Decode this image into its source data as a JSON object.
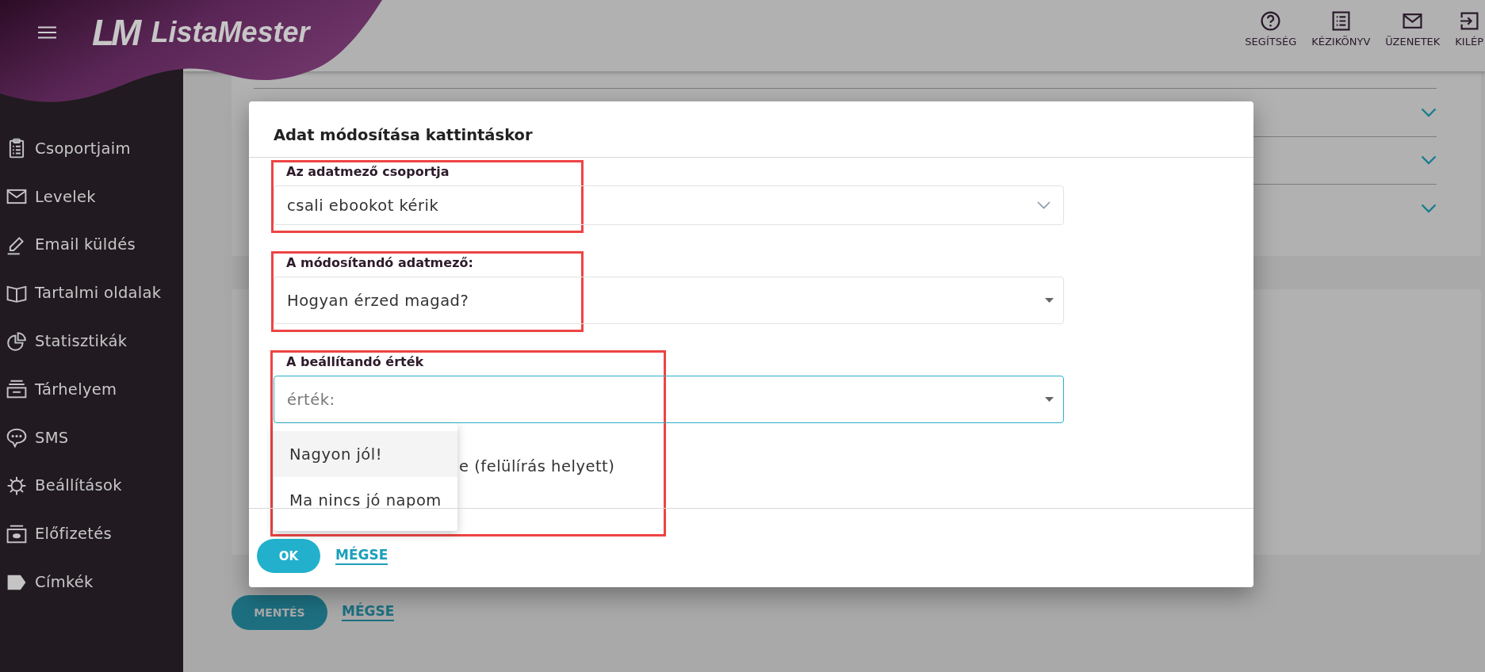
{
  "header": {
    "brand": {
      "mark": "LM",
      "name": "ListaMester"
    },
    "nav": [
      {
        "label": "SEGÍTSÉG",
        "kind": "help"
      },
      {
        "label": "KÉZIKÖNYV",
        "kind": "manual"
      },
      {
        "label": "ÜZENETEK",
        "kind": "messages"
      },
      {
        "label": "KILÉP",
        "kind": "logout"
      }
    ]
  },
  "sidebar": {
    "items": [
      {
        "label": "Csoportjaim",
        "kind": "groups"
      },
      {
        "label": "Levelek",
        "kind": "letters"
      },
      {
        "label": "Email küldés",
        "kind": "send"
      },
      {
        "label": "Tartalmi oldalak",
        "kind": "pages"
      },
      {
        "label": "Statisztikák",
        "kind": "stats"
      },
      {
        "label": "Tárhelyem",
        "kind": "storage"
      },
      {
        "label": "SMS",
        "kind": "sms"
      },
      {
        "label": "Beállítások",
        "kind": "settings"
      },
      {
        "label": "Előfizetés",
        "kind": "subscription"
      },
      {
        "label": "Címkék",
        "kind": "tags"
      }
    ]
  },
  "background": {
    "accordion_rows": [
      {
        "expanded": false
      },
      {
        "expanded": false
      },
      {
        "expanded": false
      }
    ],
    "buttons": [
      {
        "label": "MENTÉS",
        "kind": "save"
      },
      {
        "label": "MÉGSE",
        "kind": "cancel"
      }
    ]
  },
  "dialog": {
    "title": "Adat módosítása kattintáskor",
    "fields": [
      {
        "label": "Az adatmező csoportja",
        "kind": "chevron-select",
        "value": "csali ebookot kérik",
        "highlighted": true,
        "expanded": false
      },
      {
        "label": "A módosítandó adatmező:",
        "kind": "caret-select",
        "value": "Hogyan érzed magad?",
        "highlighted": true,
        "expanded": false
      },
      {
        "label": "A beállítandó érték",
        "kind": "caret-select",
        "placeholder": "érték:",
        "highlighted": true,
        "expanded": true,
        "options": [
          {
            "label": "Nagyon jól!",
            "selected": true
          },
          {
            "label": "Ma nincs jó napom",
            "selected": false
          }
        ]
      }
    ],
    "option_row": {
      "label": "e (felülírás helyett)"
    },
    "buttons": [
      {
        "label": "OK",
        "kind": "ok"
      },
      {
        "label": "MÉGSE",
        "kind": "cancel"
      }
    ]
  }
}
